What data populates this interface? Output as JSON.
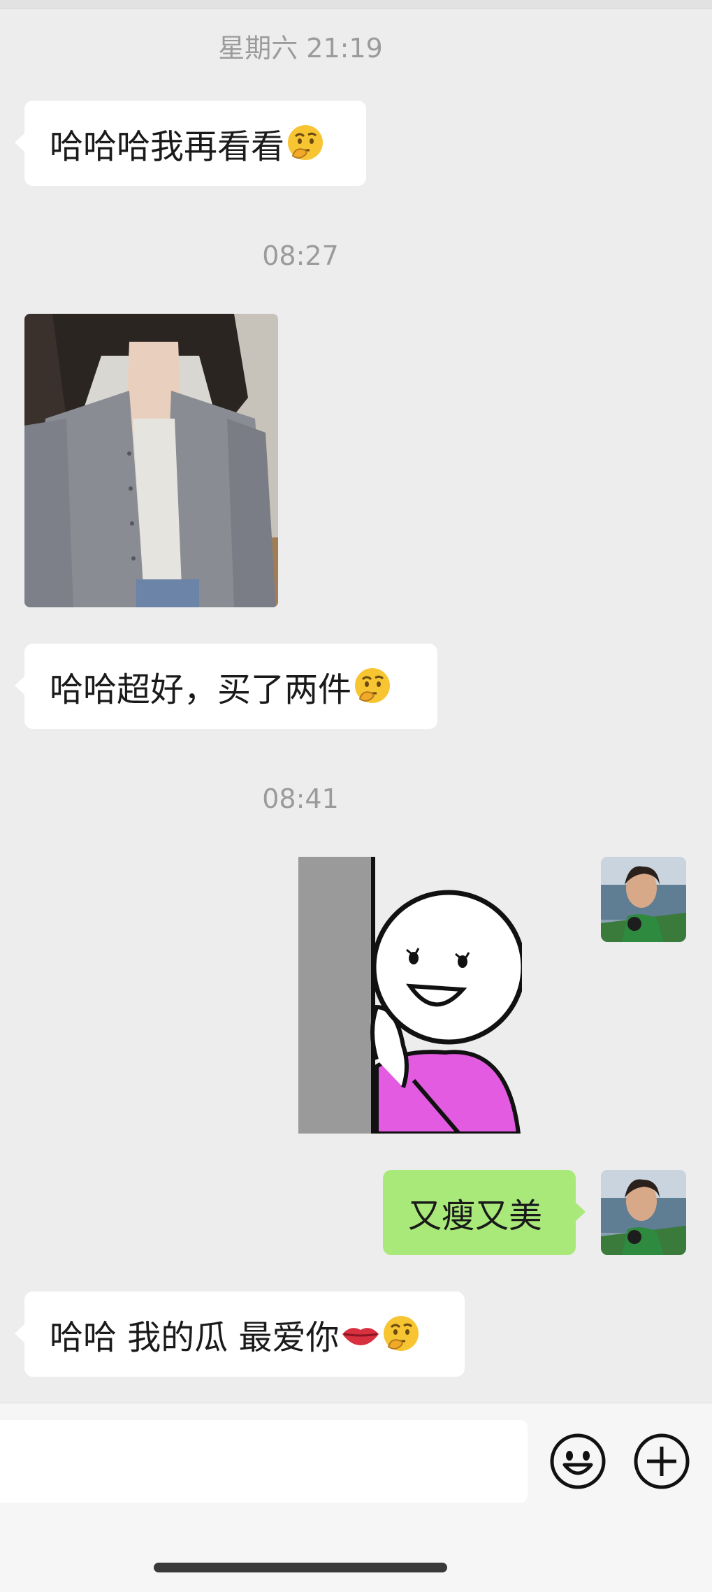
{
  "timestamps": [
    "星期六 21:19",
    "08:27",
    "08:41"
  ],
  "messages": {
    "m1": "哈哈哈我再看看",
    "m2": "哈哈超好，买了两件",
    "m3": "又瘦又美",
    "m4": "哈哈 我的瓜 最爱你"
  },
  "emoji": {
    "thinking": "thinking-face-emoji",
    "lips": "lips-emoji"
  },
  "colors": {
    "background": "#ededed",
    "incoming_bubble": "#ffffff",
    "outgoing_bubble": "#a9e97a",
    "timestamp_text": "#9b9b9b"
  },
  "input": {
    "value": "",
    "icons": [
      "smiley-face-icon",
      "plus-circle-icon"
    ]
  }
}
